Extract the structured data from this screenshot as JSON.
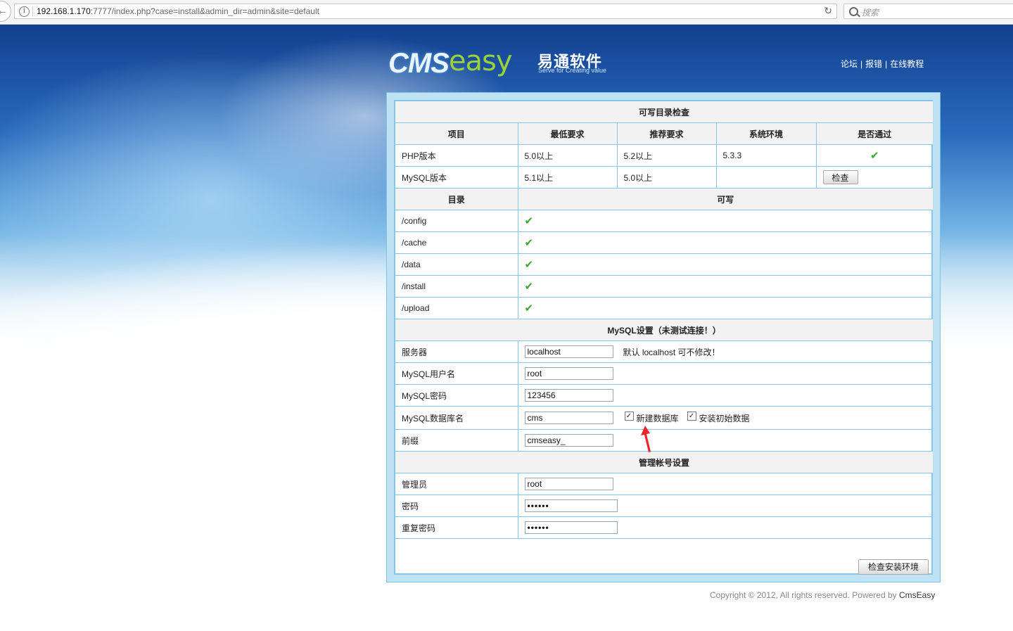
{
  "browser": {
    "url_host": "192.168.1.170",
    "url_rest": ":7777/index.php?case=install&admin_dir=admin&site=default",
    "search_placeholder": "搜索"
  },
  "header": {
    "logo_cms": "CMS",
    "logo_easy": "easy",
    "logo_cn": "易通软件",
    "logo_sub": "Serve for Creating value",
    "links": [
      "论坛",
      "报错",
      "在线教程"
    ],
    "link_sep": "|"
  },
  "env_check": {
    "title": "可写目录检查",
    "columns": [
      "项目",
      "最低要求",
      "推荐要求",
      "系统环境",
      "是否通过"
    ],
    "rows": [
      {
        "item": "PHP版本",
        "min": "5.0以上",
        "rec": "5.2以上",
        "env": "5.3.3",
        "pass": "✔"
      },
      {
        "item": "MySQL版本",
        "min": "5.1以上",
        "rec": "5.0以上",
        "env": "",
        "button": "检查"
      }
    ]
  },
  "dirs": {
    "col_dir": "目录",
    "col_writable": "可写",
    "rows": [
      {
        "dir": "/config",
        "ok": "✔"
      },
      {
        "dir": "/cache",
        "ok": "✔"
      },
      {
        "dir": "/data",
        "ok": "✔"
      },
      {
        "dir": "/install",
        "ok": "✔"
      },
      {
        "dir": "/upload",
        "ok": "✔"
      }
    ]
  },
  "mysql": {
    "title": "MySQL设置（未测试连接！）",
    "server_label": "服务器",
    "server_value": "localhost",
    "server_hint": "默认 localhost 可不修改！",
    "user_label": "MySQL用户名",
    "user_value": "root",
    "password_label": "MySQL密码",
    "password_value": "123456",
    "dbname_label": "MySQL数据库名",
    "dbname_value": "cms",
    "create_db_label": "新建数据库",
    "create_db_checked": true,
    "install_data_label": "安装初始数据",
    "install_data_checked": true,
    "prefix_label": "前缀",
    "prefix_value": "cmseasy_"
  },
  "admin": {
    "title": "管理帐号设置",
    "user_label": "管理员",
    "user_value": "root",
    "password_label": "密码",
    "password_value": "••••••",
    "repeat_label": "重复密码",
    "repeat_value": "••••••"
  },
  "actions": {
    "submit_label": "检查安装环境"
  },
  "footer": {
    "copyright": "Copyright © 2012, All rights reserved. Powered by ",
    "brand": "CmsEasy"
  },
  "colors": {
    "table_border": "#86c6e8",
    "check_green": "#3aa832",
    "arrow_red": "#e8262b"
  }
}
